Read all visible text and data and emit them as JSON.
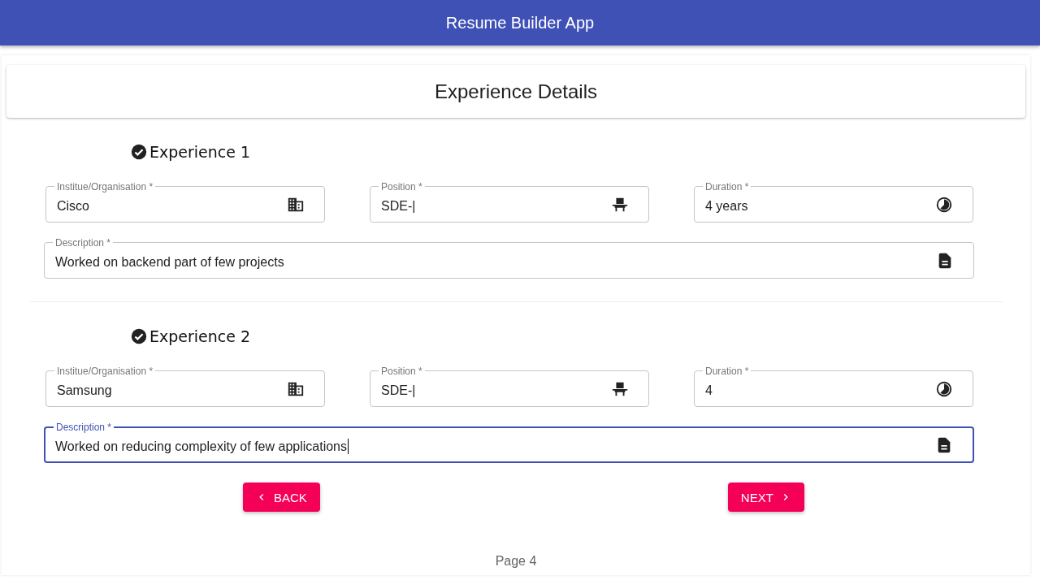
{
  "app_bar": {
    "title": "Resume Builder App"
  },
  "page_title": "Experience Details",
  "sections": [
    {
      "heading": "Experience 1",
      "completed": true,
      "fields": [
        {
          "label": "Institue/Organisation *",
          "value": "Cisco",
          "kind": "organisation",
          "focused": false
        },
        {
          "label": "Position *",
          "value": "SDE-|",
          "kind": "position",
          "focused": false
        },
        {
          "label": "Duration *",
          "value": "4 years",
          "kind": "duration",
          "focused": false
        },
        {
          "label": "Description *",
          "value": "Worked on backend part of few projects",
          "kind": "description",
          "focused": false
        }
      ]
    },
    {
      "heading": "Experience 2",
      "completed": true,
      "fields": [
        {
          "label": "Institue/Organisation *",
          "value": "Samsung",
          "kind": "organisation",
          "focused": false
        },
        {
          "label": "Position *",
          "value": "SDE-|",
          "kind": "position",
          "focused": false
        },
        {
          "label": "Duration *",
          "value": "4",
          "kind": "duration",
          "focused": false
        },
        {
          "label": "Description *",
          "value": "Worked on reducing complexity of few applications",
          "kind": "description",
          "focused": true
        }
      ]
    }
  ],
  "buttons": [
    {
      "label": "BACK",
      "kind": "back"
    },
    {
      "label": "NEXT",
      "kind": "next"
    }
  ],
  "footer": "Page 4"
}
